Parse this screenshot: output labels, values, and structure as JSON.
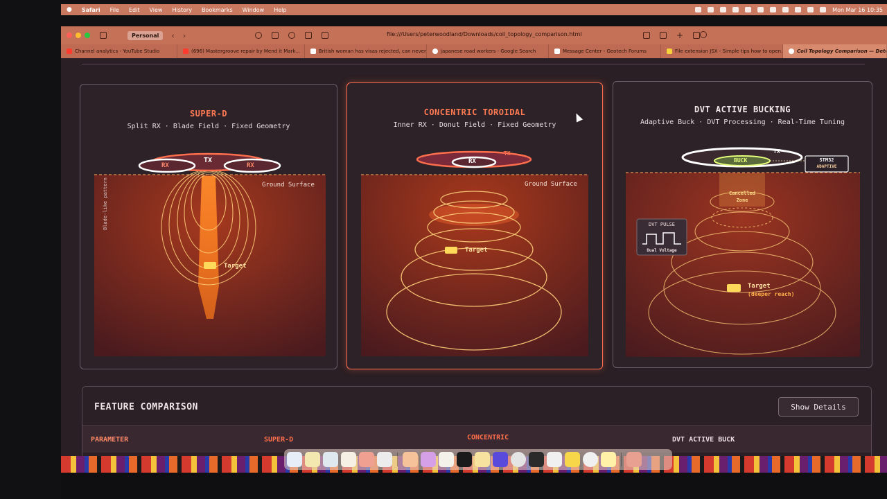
{
  "menubar": {
    "app": "Safari",
    "items": [
      "File",
      "Edit",
      "View",
      "History",
      "Bookmarks",
      "Window",
      "Help"
    ],
    "clock": "Mon Mar 16  10:35"
  },
  "toolbar": {
    "profile": "Personal",
    "url": "file:///Users/peterwoodland/Downloads/coil_topology_comparison.html"
  },
  "tabs": [
    {
      "label": "Channel analytics - YouTube Studio",
      "color": "#ff3b30"
    },
    {
      "label": "(696) Mastergroove repair by Mend it Mark...",
      "color": "#ff3b30"
    },
    {
      "label": "British woman has visas rejected, can never...",
      "color": "#ffffff"
    },
    {
      "label": "japanese road workers - Google Search",
      "color": "#ffffff"
    },
    {
      "label": "Message Center - Geotech Forums",
      "color": "#ffffff"
    },
    {
      "label": "File extension JSX - Simple tips how to open...",
      "color": "#f7d23a"
    },
    {
      "label": "Coil Topology Comparison — DetectorMade",
      "color": "#ffffff"
    }
  ],
  "cards": [
    {
      "title": "SUPER-D",
      "subtitle": "Split RX · Blade Field · Fixed Geometry",
      "title_color": "#ff7a52",
      "labels": {
        "tx": "TX",
        "rx_left": "RX",
        "rx_right": "RX",
        "ground": "Ground Surface",
        "side": "Blade-like pattern",
        "target": "Target"
      }
    },
    {
      "title": "CONCENTRIC TOROIDAL",
      "subtitle": "Inner RX · Donut Field · Fixed Geometry",
      "title_color": "#ff7a52",
      "labels": {
        "tx": "TX",
        "rx": "RX",
        "ground": "Ground Surface",
        "target": "Target"
      }
    },
    {
      "title": "DVT ACTIVE BUCKING",
      "subtitle": "Adaptive Buck · DVT Processing · Real-Time Tuning",
      "title_color": "#f2e6e8",
      "labels": {
        "tx": "TX",
        "buck": "BUCK",
        "chip_line1": "STM32",
        "chip_line2": "ADAPTIVE",
        "cancelled_line1": "Cancelled",
        "cancelled_line2": "Zone",
        "pulse_title": "DVT PULSE",
        "pulse_sub": "Dual Voltage",
        "target": "Target",
        "target_note": "(deeper reach)"
      }
    }
  ],
  "feature": {
    "title": "FEATURE COMPARISON",
    "details_button": "Show Details",
    "columns": [
      {
        "label": "PARAMETER",
        "color": "#ff8a6a"
      },
      {
        "label": "SUPER-D",
        "color": "#ff6f4e"
      },
      {
        "label": "CONCENTRIC",
        "color": "#ff6f4e"
      },
      {
        "label": "DVT ACTIVE BUCK",
        "color": "#e9dde0"
      }
    ]
  },
  "colors": {
    "accent": "#ff6f4e",
    "field": "#ffc46b",
    "panel": "#2d2228"
  },
  "dock_apps": [
    "finder-icon",
    "notes-icon",
    "maps-icon",
    "photos-icon",
    "music-icon",
    "box-icon",
    "preview-icon",
    "kindle-icon",
    "files-icon",
    "capcut-icon",
    "folder-icon",
    "calendar-icon",
    "settings-icon",
    "terminal-icon",
    "textedit-icon",
    "drive-icon",
    "magnifier-icon",
    "stickies-icon",
    "trash-icon"
  ]
}
